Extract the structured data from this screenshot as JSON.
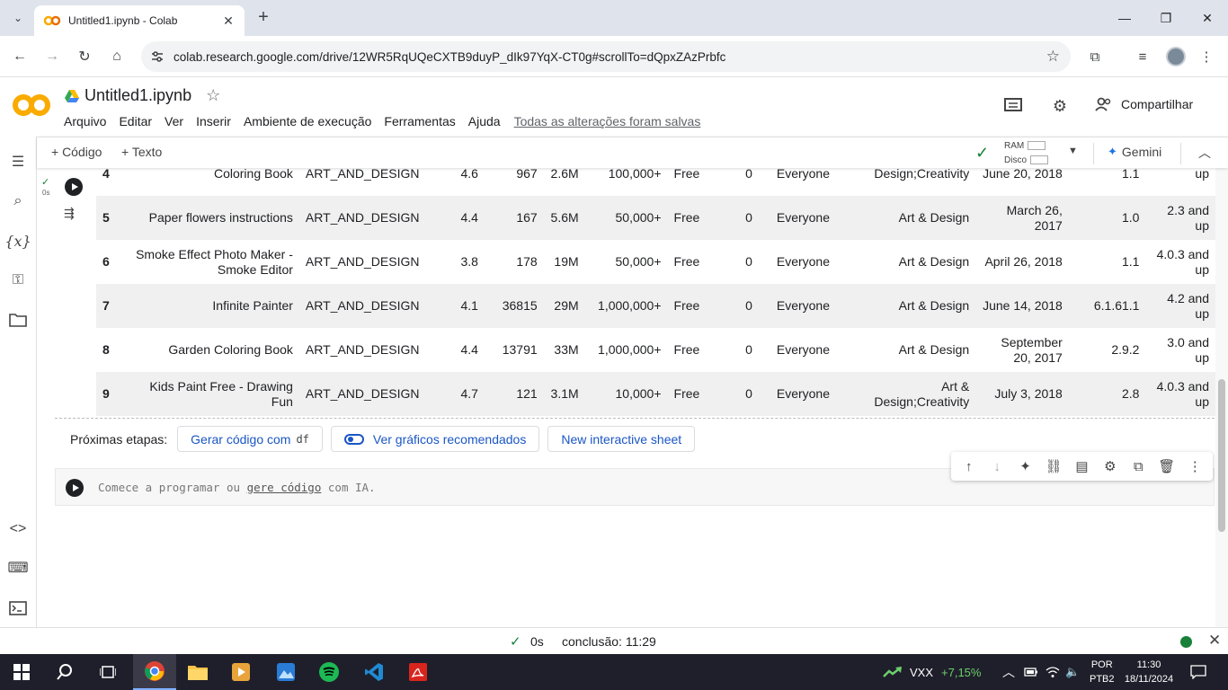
{
  "browser": {
    "tab_title": "Untitled1.ipynb - Colab",
    "url": "colab.research.google.com/drive/12WR5RqUQeCXTB9duyP_dIk97YqX-CT0g#scrollTo=dQpxZAzPrbfc"
  },
  "colab": {
    "notebook_title": "Untitled1.ipynb",
    "menu": [
      "Arquivo",
      "Editar",
      "Ver",
      "Inserir",
      "Ambiente de execução",
      "Ferramentas",
      "Ajuda"
    ],
    "saved_status": "Todas as alterações foram salvas",
    "share_label": "Compartilhar",
    "add_code": "+ Código",
    "add_text": "+ Texto",
    "ram_label": "RAM",
    "disk_label": "Disco",
    "gemini_label": "Gemini",
    "exec_time_small": "0s"
  },
  "table": {
    "partial_row": {
      "idx": "4",
      "app": "Coloring Book",
      "category": "ART_AND_DESIGN",
      "rating": "4.6",
      "reviews": "967",
      "size": "2.6M",
      "installs": "100,000+",
      "type": "Free",
      "price": "0",
      "content_rating": "Everyone",
      "genres": "Design;Creativity",
      "updated": "June 20, 2018",
      "version": "1.1",
      "android": "up"
    },
    "rows": [
      {
        "idx": "5",
        "app": "Paper flowers instructions",
        "category": "ART_AND_DESIGN",
        "rating": "4.4",
        "reviews": "167",
        "size": "5.6M",
        "installs": "50,000+",
        "type": "Free",
        "price": "0",
        "content_rating": "Everyone",
        "genres": "Art & Design",
        "updated": "March 26, 2017",
        "version": "1.0",
        "android": "2.3 and up"
      },
      {
        "idx": "6",
        "app": "Smoke Effect Photo Maker - Smoke Editor",
        "category": "ART_AND_DESIGN",
        "rating": "3.8",
        "reviews": "178",
        "size": "19M",
        "installs": "50,000+",
        "type": "Free",
        "price": "0",
        "content_rating": "Everyone",
        "genres": "Art & Design",
        "updated": "April 26, 2018",
        "version": "1.1",
        "android": "4.0.3 and up"
      },
      {
        "idx": "7",
        "app": "Infinite Painter",
        "category": "ART_AND_DESIGN",
        "rating": "4.1",
        "reviews": "36815",
        "size": "29M",
        "installs": "1,000,000+",
        "type": "Free",
        "price": "0",
        "content_rating": "Everyone",
        "genres": "Art & Design",
        "updated": "June 14, 2018",
        "version": "6.1.61.1",
        "android": "4.2 and up"
      },
      {
        "idx": "8",
        "app": "Garden Coloring Book",
        "category": "ART_AND_DESIGN",
        "rating": "4.4",
        "reviews": "13791",
        "size": "33M",
        "installs": "1,000,000+",
        "type": "Free",
        "price": "0",
        "content_rating": "Everyone",
        "genres": "Art & Design",
        "updated": "September 20, 2017",
        "version": "2.9.2",
        "android": "3.0 and up"
      },
      {
        "idx": "9",
        "app": "Kids Paint Free - Drawing Fun",
        "category": "ART_AND_DESIGN",
        "rating": "4.7",
        "reviews": "121",
        "size": "3.1M",
        "installs": "10,000+",
        "type": "Free",
        "price": "0",
        "content_rating": "Everyone",
        "genres": "Art & Design;Creativity",
        "updated": "July 3, 2018",
        "version": "2.8",
        "android": "4.0.3 and up"
      }
    ]
  },
  "next_steps": {
    "label": "Próximas etapas:",
    "gen_code": "Gerar código com",
    "gen_code_var": "df",
    "charts": "Ver gráficos recomendados",
    "sheet": "New interactive sheet"
  },
  "code_cell": {
    "placeholder_prefix": "Comece a programar ou ",
    "placeholder_link": "gere código",
    "placeholder_suffix": " com IA."
  },
  "status": {
    "elapsed": "0s",
    "completion": "conclusão: 11:29"
  },
  "taskbar": {
    "stock_name": "VXX",
    "stock_change": "+7,15%",
    "lang_line1": "POR",
    "lang_line2": "PTB2",
    "time": "11:30",
    "date": "18/11/2024"
  },
  "colors": {
    "colab_orange": "#f9ab00",
    "link_blue": "#1a56c4",
    "ok_green": "#188038",
    "stock_green": "#6ccf6c"
  }
}
